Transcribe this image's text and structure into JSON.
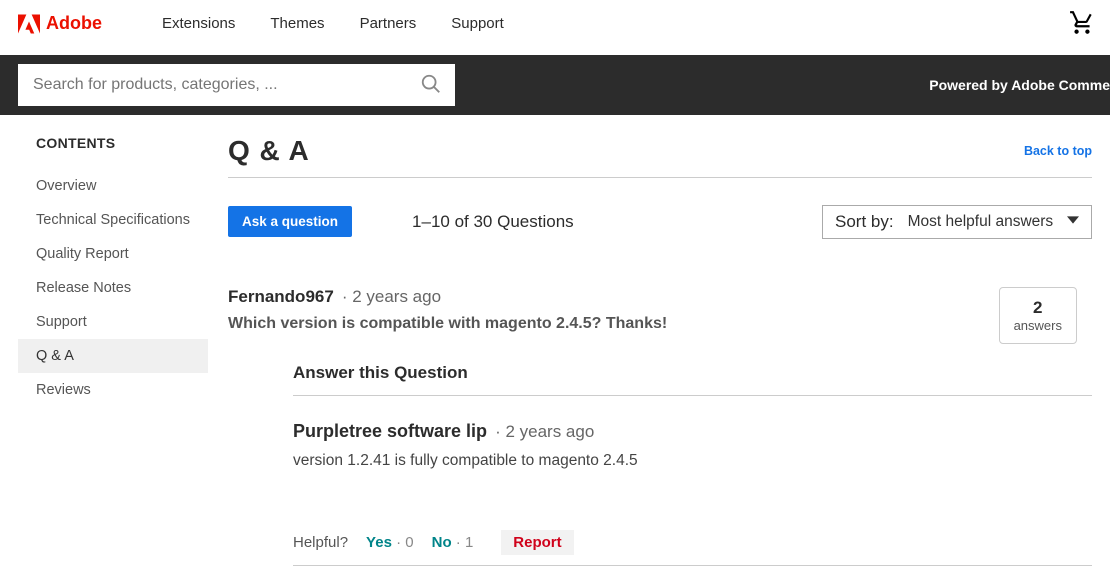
{
  "brand": "Adobe",
  "nav": {
    "extensions": "Extensions",
    "themes": "Themes",
    "partners": "Partners",
    "support": "Support"
  },
  "search": {
    "placeholder": "Search for products, categories, ..."
  },
  "powered": "Powered by Adobe Comme",
  "sidebar": {
    "title": "CONTENTS",
    "items": {
      "overview": "Overview",
      "tech": "Technical Specifications",
      "quality": "Quality Report",
      "release": "Release Notes",
      "support": "Support",
      "qa": "Q & A",
      "reviews": "Reviews"
    }
  },
  "qa": {
    "title": "Q & A",
    "back": "Back to top",
    "ask": "Ask a question",
    "count": "1–10 of 30 Questions",
    "sort_label": "Sort by:",
    "sort_value": "Most helpful answers"
  },
  "question": {
    "user": "Fernando967",
    "time": "2 years ago",
    "text": "Which version is compatible with magento 2.4.5? Thanks!",
    "answers_count": "2",
    "answers_label": "answers"
  },
  "answer": {
    "section": "Answer this Question",
    "user": "Purpletree software lip",
    "time": "2 years ago",
    "text": "version 1.2.41 is fully compatible to magento 2.4.5"
  },
  "helpful": {
    "label": "Helpful?",
    "yes": "Yes",
    "yes_cnt": "0",
    "no": "No",
    "no_cnt": "1",
    "report": "Report"
  }
}
